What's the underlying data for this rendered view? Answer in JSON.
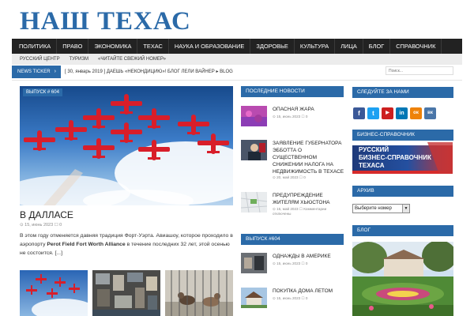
{
  "site": {
    "title": "НАШ ТЕХАС"
  },
  "nav": {
    "items": [
      "ПОЛИТИКА",
      "ПРАВО",
      "ЭКОНОМИКА",
      "ТЕХАС",
      "НАУКА И ОБРАЗОВАНИЕ",
      "ЗДОРОВЬЕ",
      "КУЛЬТУРА",
      "ЛИЦА",
      "БЛОГ",
      "СПРАВОЧНИК"
    ]
  },
  "subnav": {
    "items": [
      "РУССКИЙ ЦЕНТР",
      "ТУРИЗМ",
      "«ЧИТАЙТЕ СВЕЖИЙ НОМЕР»"
    ]
  },
  "ticker": {
    "label": "NEWS TICKER",
    "arrow": "›",
    "date": "[ 30, январь 2019 ]",
    "headline": "ДАЕШЬ «НЕКОНДИЦИЮ»! БЛОГ ЛЕЛИ ВАЙНЕР",
    "bullet": "▸",
    "category": "BLOG"
  },
  "search": {
    "placeholder": "Поиск..."
  },
  "featured": {
    "badge": "ВЫПУСК # 604",
    "title": "В ДАЛЛАСЕ",
    "meta": "⊙ 15, июнь 2023   ☐ 0",
    "excerpt_before": "В этом году отменяется давняя традиция Форт-Уэрта. Авиашоу, которое проходило в аэропорту ",
    "excerpt_bold": "Perot Field Fort Worth Alliance",
    "excerpt_after": " в течение последних 32 лет, этой осенью не состоится. [...]"
  },
  "latest": {
    "heading": "ПОСЛЕДНИЕ НОВОСТИ",
    "posts": [
      {
        "title": "ОПАСНАЯ ЖАРА",
        "meta": "⊙ 15, июнь 2023   ☐ 0"
      },
      {
        "title": "ЗАЯВЛЕНИЕ ГУБЕРНАТОРА ЭББОТТА О СУЩЕСТВЕННОМ СНИЖЕНИИ НАЛОГА НА НЕДВИЖИМОСТЬ В ТЕХАСЕ",
        "meta": "⊙ 20, май 2023   ☐ 0"
      },
      {
        "title": "ПРЕДУПРЕЖДЕНИЕ ЖИТЕЛЯМ ХЬЮСТОНА",
        "meta": "⊙ 15, май 2023   ☐ Комментарии отключены"
      }
    ]
  },
  "issue": {
    "heading": "ВЫПУСК #604",
    "posts": [
      {
        "title": "ОДНАЖДЫ В АМЕРИКЕ",
        "meta": "⊙ 15, июнь 2023   ☐ 0"
      },
      {
        "title": "ПОКУПКА ДОМА ЛЕТОМ",
        "meta": "⊙ 15, июнь 2023   ☐ 0"
      }
    ]
  },
  "follow": {
    "heading": "СЛЕДУЙТЕ ЗА НАМИ",
    "icons": [
      "f",
      "t",
      "▶",
      "in",
      "ок",
      "вк"
    ]
  },
  "business": {
    "heading": "БИЗНЕС-СПРАВОЧНИК",
    "line1": "РУССКИЙ",
    "line2": "БИЗНЕС-СПРАВОЧНИК",
    "line3": "ТЕХАСА"
  },
  "archive": {
    "heading": "АРХИВ",
    "select": "Выберите номер"
  },
  "blog": {
    "heading": "БЛОГ"
  },
  "colors": {
    "accent": "#2b6aa8",
    "nav_bg": "#222222",
    "subnav_bg": "#ececec"
  }
}
